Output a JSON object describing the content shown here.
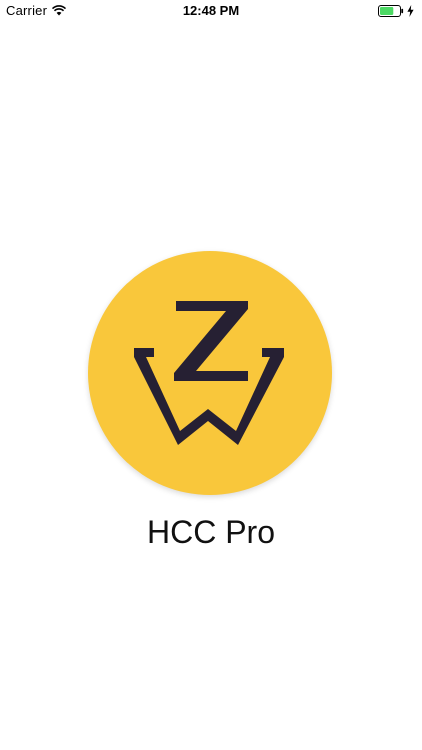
{
  "status_bar": {
    "carrier": "Carrier",
    "time": "12:48 PM",
    "battery_level": 0.7,
    "battery_color": "#4cd964",
    "icons": [
      "wifi-icon",
      "battery-icon",
      "bolt-icon"
    ]
  },
  "splash": {
    "app_name": "HCC Pro",
    "logo_colors": {
      "background": "#f9c73b",
      "mark": "#262033"
    },
    "logo_icon": "zw-logo-icon"
  }
}
